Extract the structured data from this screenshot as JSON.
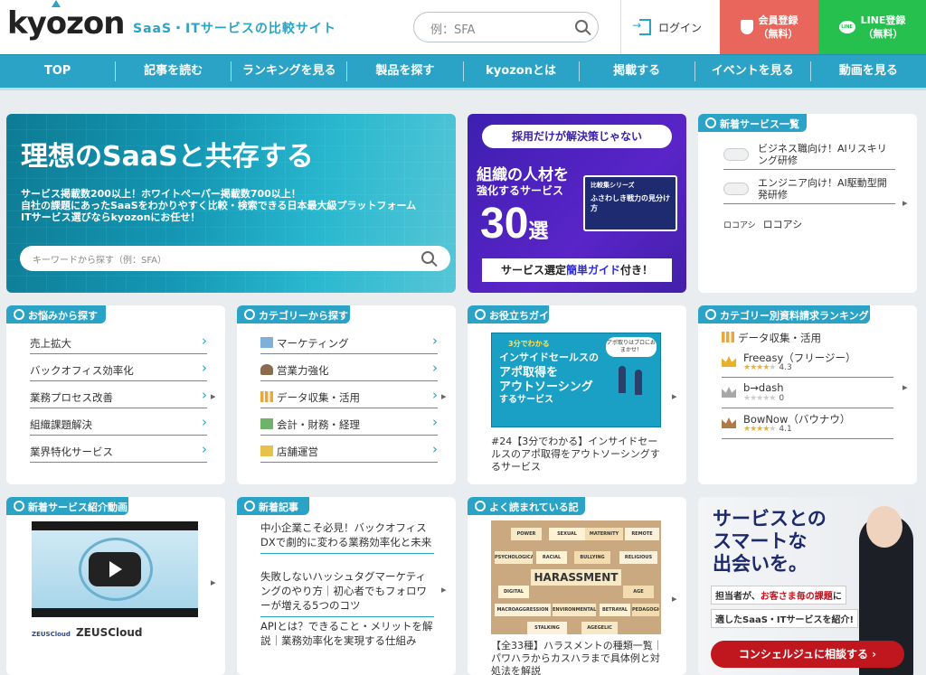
{
  "header": {
    "logo": "kyozon",
    "tagline": "SaaS・ITサービスの比較サイト",
    "search_placeholder": "例：SFA",
    "login": "ログイン",
    "member_line1": "会員登録",
    "member_line2": "（無料）",
    "line_line1": "LINE登録",
    "line_line2": "（無料）",
    "line_icon_text": "LINE"
  },
  "nav": [
    "TOP",
    "記事を読む",
    "ランキングを見る",
    "製品を探す",
    "kyozonとは",
    "掲載する",
    "イベントを見る",
    "動画を見る"
  ],
  "hero": {
    "title": "理想のSaaSと共存する",
    "line1": "サービス掲載数200以上！ホワイトペーパー掲載数700以上！",
    "line2": "自社の課題にあったSaaSをわかりやすく比較・検索できる日本最大級プラットフォーム",
    "line3": "ITサービス選びならkyozonにお任せ！",
    "search_placeholder": "キーワードから探す（例：SFA）"
  },
  "banner": {
    "pill": "採用だけが解決策じゃない",
    "t1": "組織の人材を",
    "t2": "強化するサービス",
    "num": "30",
    "num_suffix": "選",
    "book_series": "比較集シリーズ",
    "book_title": "ふさわしき戦力の見分け方",
    "bottom_a": "サービス選定",
    "bottom_b": "簡単ガイド",
    "bottom_c": "付き！"
  },
  "new_services": {
    "title": "新着サービス一覧",
    "items": [
      "ビジネス職向け！AIリスキリング研修",
      "エンジニア向け！AI駆動型開発研修",
      "ロコアシ"
    ],
    "logo_text": "ロコアシ"
  },
  "worries": {
    "title": "お悩みから探す",
    "items": [
      "売上拡大",
      "バックオフィス効率化",
      "業務プロセス改善",
      "組織課題解決",
      "業界特化サービス"
    ]
  },
  "categories": {
    "title": "カテゴリーから探す",
    "items": [
      "マーケティング",
      "営業力強化",
      "データ収集・活用",
      "会計・財務・経理",
      "店舗運営"
    ]
  },
  "guide": {
    "title": "お役立ちガイド",
    "img_tag": "3分でわかる",
    "img_l1": "インサイドセールスの",
    "img_l2": "アポ取得を",
    "img_l3": "アウトソーシング",
    "img_l4": "するサービス",
    "bubble": "アポ取りはプロにおまかせ！",
    "caption": "#24【3分でわかる】インサイドセールスのアポ取得をアウトソーシングするサービス"
  },
  "ranking": {
    "title": "カテゴリー別資料請求ランキング",
    "category": "データ収集・活用",
    "items": [
      {
        "name": "Freeasy（フリージー）",
        "score": "4.3",
        "stars": 4
      },
      {
        "name": "b→dash",
        "score": "0",
        "stars": 0
      },
      {
        "name": "BowNow（バウナウ）",
        "score": "4.1",
        "stars": 4
      }
    ]
  },
  "video": {
    "title": "新着サービス紹介動画",
    "caption": "ZEUSCloud",
    "logo_small": "ZEUSCloud"
  },
  "news": {
    "title": "新着記事",
    "items": [
      "中小企業こそ必見！バックオフィスDXで劇的に変わる業務効率化と未来",
      "失敗しないハッシュタグマーケティングのやり方｜初心者でもフォロワーが増える5つのコツ",
      "APIとは？できること・メリットを解説｜業務効率化を実現する仕組み"
    ]
  },
  "popular": {
    "title": "よく読まれている記事",
    "notes": [
      "POWER",
      "SEXUAL",
      "MATERNITY",
      "REMOTE",
      "PSYCHOLOGICAL",
      "RACIAL",
      "BULLYING",
      "RELIGIOUS",
      "HARASSMENT",
      "DIGITAL",
      "AGE",
      "MACROAGGRESSION",
      "ENVIRONMENTAL",
      "BETRAYAL",
      "PEDAGOGICAL",
      "STALKING",
      "AGEGELIC"
    ],
    "caption": "【全33種】ハラスメントの種類一覧｜パワハラからカスハラまで具体例と対処法を解説"
  },
  "concierge": {
    "l1": "サービスとの",
    "l2": "スマートな",
    "l3": "出会いを。",
    "p1a": "担当者が、",
    "p1b": "お客さま毎の課題",
    "p1c": "に",
    "p2": "適したSaaS・ITサービスを紹介!",
    "button": "コンシェルジュに相談する ›"
  },
  "colors": {
    "accent": "#2aa3c7",
    "member": "#e8665c",
    "line": "#26c04f",
    "banner": "#4a22b8",
    "concierge_btn": "#c0161e"
  }
}
